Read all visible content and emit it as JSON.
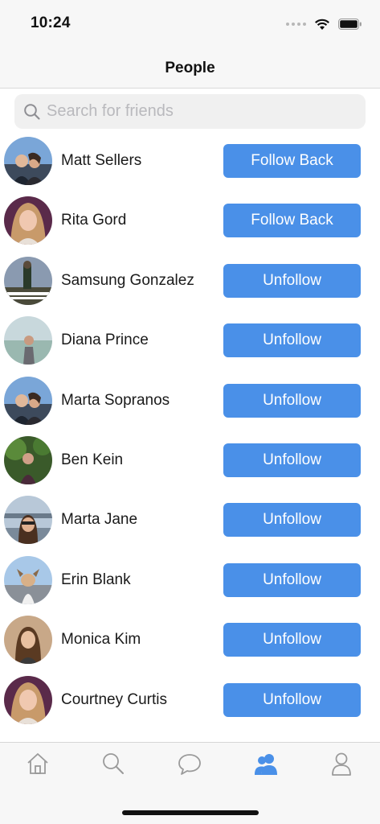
{
  "status_bar": {
    "time": "10:24"
  },
  "nav": {
    "title": "People"
  },
  "search": {
    "placeholder": "Search for friends"
  },
  "people": [
    {
      "name": "Matt Sellers",
      "action": "Follow Back"
    },
    {
      "name": "Rita Gord",
      "action": "Follow Back"
    },
    {
      "name": "Samsung Gonzalez",
      "action": "Unfollow"
    },
    {
      "name": "Diana Prince",
      "action": "Unfollow"
    },
    {
      "name": "Marta Sopranos",
      "action": "Unfollow"
    },
    {
      "name": "Ben Kein",
      "action": "Unfollow"
    },
    {
      "name": "Marta Jane",
      "action": "Unfollow"
    },
    {
      "name": "Erin Blank",
      "action": "Unfollow"
    },
    {
      "name": "Monica Kim",
      "action": "Unfollow"
    },
    {
      "name": "Courtney Curtis",
      "action": "Unfollow"
    }
  ],
  "tabs": [
    {
      "icon": "home-icon",
      "active": false
    },
    {
      "icon": "search-icon",
      "active": false
    },
    {
      "icon": "chat-icon",
      "active": false
    },
    {
      "icon": "people-icon",
      "active": true
    },
    {
      "icon": "profile-icon",
      "active": false
    }
  ],
  "colors": {
    "accent": "#4a90e8",
    "inactive_tab": "#9a9a9a"
  }
}
